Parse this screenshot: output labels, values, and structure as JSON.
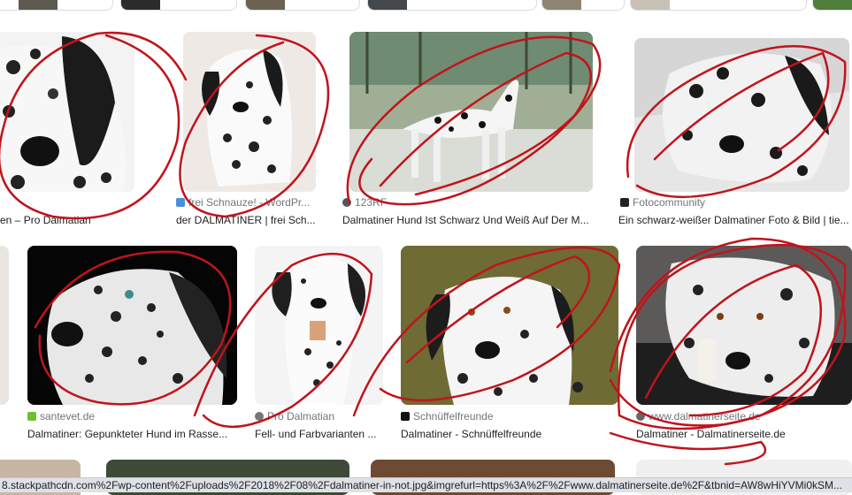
{
  "results": [
    {
      "source": "",
      "title": "en – Pro Dalmatian"
    },
    {
      "source": "frei Schnauze! - WordPr...",
      "title": "der DALMATINER | frei Sch..."
    },
    {
      "source": "123RF",
      "title": "Dalmatiner Hund Ist Schwarz Und Weiß Auf Der M..."
    },
    {
      "source": "Fotocommunity",
      "title": "Ein schwarz-weißer Dalmatiner Foto & Bild | tie..."
    },
    {
      "source": "santevet.de",
      "title": "Dalmatiner: Gepunkteter Hund im Rasse..."
    },
    {
      "source": "Pro Dalmatian",
      "title": "Fell- und Farbvarianten ..."
    },
    {
      "source": "Schnüffelfreunde",
      "title": "Dalmatiner - Schnüffelfreunde"
    },
    {
      "source": "www.dalmatinerseite.de",
      "title": "Dalmatiner - Dalmatinerseite.de"
    }
  ],
  "status_url": "8.stackpathcdn.com%2Fwp-content%2Fuploads%2F2018%2F08%2Fdalmatiner-in-not.jpg&imgrefurl=https%3A%2F%2Fwww.dalmatinerseite.de%2F&tbnid=AW8wHiYVMi0kSM...",
  "colors": {
    "annotation": "#c0141c",
    "favicon_santevet": "#6fbf2f",
    "favicon_123rf": "#555555"
  }
}
